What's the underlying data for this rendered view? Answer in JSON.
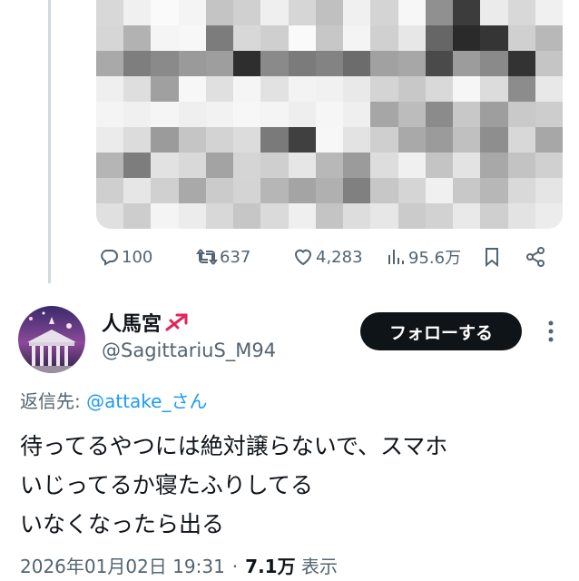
{
  "mosaic_shades": [
    [
      "#d8d8d8",
      "#f0f0f0",
      "#fafafa",
      "#f4f4f4",
      "#c4c4c4",
      "#d0d0d0",
      "#efefef",
      "#d6d6d6",
      "#c0c0c0",
      "#f0f0f0",
      "#d4d4d4",
      "#f7f7f7",
      "#909090",
      "#3c3c3c",
      "#ebebeb",
      "#d8d8d8",
      "#f0f0f0"
    ],
    [
      "#d6d6d6",
      "#b2b2b2",
      "#f5f5f5",
      "#f7f7f7",
      "#7c7c7c",
      "#d8d8d8",
      "#cfcfcf",
      "#fafafa",
      "#c7c7c7",
      "#f4f4f4",
      "#d0d0d0",
      "#e7e7e7",
      "#666666",
      "#2a2a2a",
      "#353535",
      "#d0d0d0",
      "#b8b8b8"
    ],
    [
      "#a9a9a9",
      "#7e7e7e",
      "#8a8a8a",
      "#9a9a9a",
      "#9e9e9e",
      "#2e2e2e",
      "#8a8a8a",
      "#7b7b7b",
      "#838383",
      "#6c6c6c",
      "#a1a1a1",
      "#a7a7a7",
      "#4a4a4a",
      "#9c9c9c",
      "#8a8a8a",
      "#333333",
      "#c5c5c5"
    ],
    [
      "#efefef",
      "#dedede",
      "#a0a0a0",
      "#f7f7f7",
      "#e0e0e0",
      "#f5f5f5",
      "#e2e2e2",
      "#f3f3f3",
      "#f1f1f1",
      "#e9e9e9",
      "#d4d4d4",
      "#c8c8c8",
      "#d9d9d9",
      "#f6f6f6",
      "#dcdcdc",
      "#8c8c8c",
      "#e8e8e8"
    ],
    [
      "#f4f4f4",
      "#f0f0f0",
      "#f5f5f5",
      "#efefef",
      "#f2f2f2",
      "#f7f7f7",
      "#f4f4f4",
      "#eeeeee",
      "#f6f6f6",
      "#efefef",
      "#a6a6a6",
      "#bcbcbc",
      "#8b8b8b",
      "#c8c8c8",
      "#9e9e9e",
      "#c9c9c9",
      "#cdcdcd"
    ],
    [
      "#ebebeb",
      "#dcdcdc",
      "#9b9b9b",
      "#c5c5c5",
      "#d3d3d3",
      "#dcdcdc",
      "#7a7a7a",
      "#404040",
      "#f7f7f7",
      "#e3e3e3",
      "#cfcfcf",
      "#a9a9a9",
      "#9b9b9b",
      "#c0c0c0",
      "#8e8e8e",
      "#d8d8d8",
      "#a7a7a7"
    ],
    [
      "#b5b5b5",
      "#7d7d7d",
      "#e2e2e2",
      "#d9d9d9",
      "#a3a3a3",
      "#d5d5d5",
      "#cfcfcf",
      "#e6e6e6",
      "#b8b8b8",
      "#9b9b9b",
      "#dddddd",
      "#f0f0f0",
      "#c4c4c4",
      "#e3e3e3",
      "#a8a8a8",
      "#c3c3c3",
      "#d0d0d0"
    ],
    [
      "#cfcfcf",
      "#e6e6e6",
      "#d0d0d0",
      "#a9a9a9",
      "#cbcbcb",
      "#d4d4d4",
      "#b6b6b6",
      "#a4a4a4",
      "#b0b0b0",
      "#808080",
      "#c7c7c7",
      "#d5d5d5",
      "#f0f0f0",
      "#c8c8c8",
      "#b7b7b7",
      "#d9d9d9",
      "#e5e5e5"
    ],
    [
      "#e0e0e0",
      "#cdcdcd",
      "#f4f4f4",
      "#ececec",
      "#d8d8d8",
      "#c6c6c6",
      "#dadada",
      "#efefef",
      "#c4c4c4",
      "#dddddd",
      "#e7e7e7",
      "#cbcbcb",
      "#d2d2d2",
      "#e9e9e9",
      "#cfcfcf",
      "#e3e3e3",
      "#ececec"
    ]
  ],
  "actions": {
    "replies": "100",
    "reposts": "637",
    "likes": "4,283",
    "views": "95.6万"
  },
  "user": {
    "name": "人馬宮",
    "handle": "@SagittariuS_M94",
    "follow_label": "フォローする"
  },
  "reply": {
    "prefix": "返信先: ",
    "target": "@attake_さん"
  },
  "tweet_text": "待ってるやつには絶対譲らないで、スマホ\nいじってるか寝たふりしてる\nいなくなったら出る",
  "meta": {
    "timestamp": "2026年01月02日 19:31",
    "dot": "·",
    "views_count": "7.1万",
    "views_label": "表示"
  },
  "colors": {
    "accent": "#1d9bf0",
    "text": "#0f1419",
    "secondary": "#536471",
    "follow_bg": "#0f1419"
  }
}
